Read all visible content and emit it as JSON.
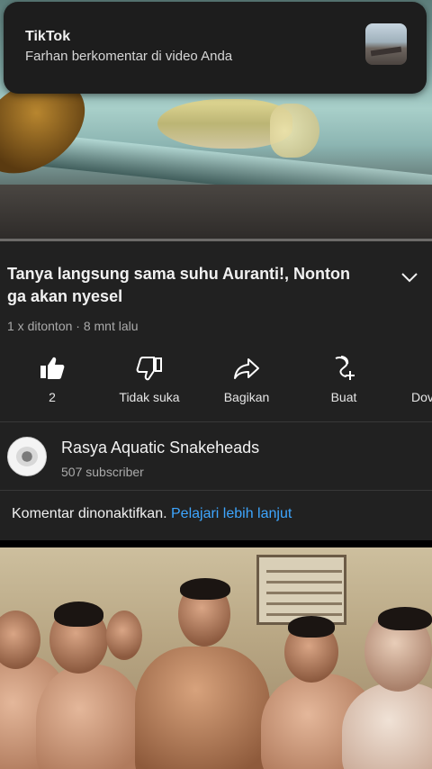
{
  "notification": {
    "app": "TikTok",
    "message": "Farhan berkomentar di video Anda"
  },
  "video": {
    "title": "Tanya langsung sama suhu Auranti!, Nonton ga akan nyesel",
    "meta": "1 x ditonton · 8 mnt lalu"
  },
  "actions": [
    {
      "label": "2",
      "icon": "thumbs-up-icon"
    },
    {
      "label": "Tidak suka",
      "icon": "thumbs-down-icon"
    },
    {
      "label": "Bagikan",
      "icon": "share-icon"
    },
    {
      "label": "Buat",
      "icon": "create-icon"
    },
    {
      "label": "Dov",
      "icon": "download-icon"
    }
  ],
  "channel": {
    "name": "Rasya Aquatic Snakeheads",
    "subscribers": "507 subscriber"
  },
  "comments": {
    "text": "Komentar dinonaktifkan.",
    "link": "Pelajari lebih lanjut"
  },
  "colors": {
    "background": "#212121",
    "link": "#3ea6ff",
    "secondary_text": "#aaaaaa"
  }
}
